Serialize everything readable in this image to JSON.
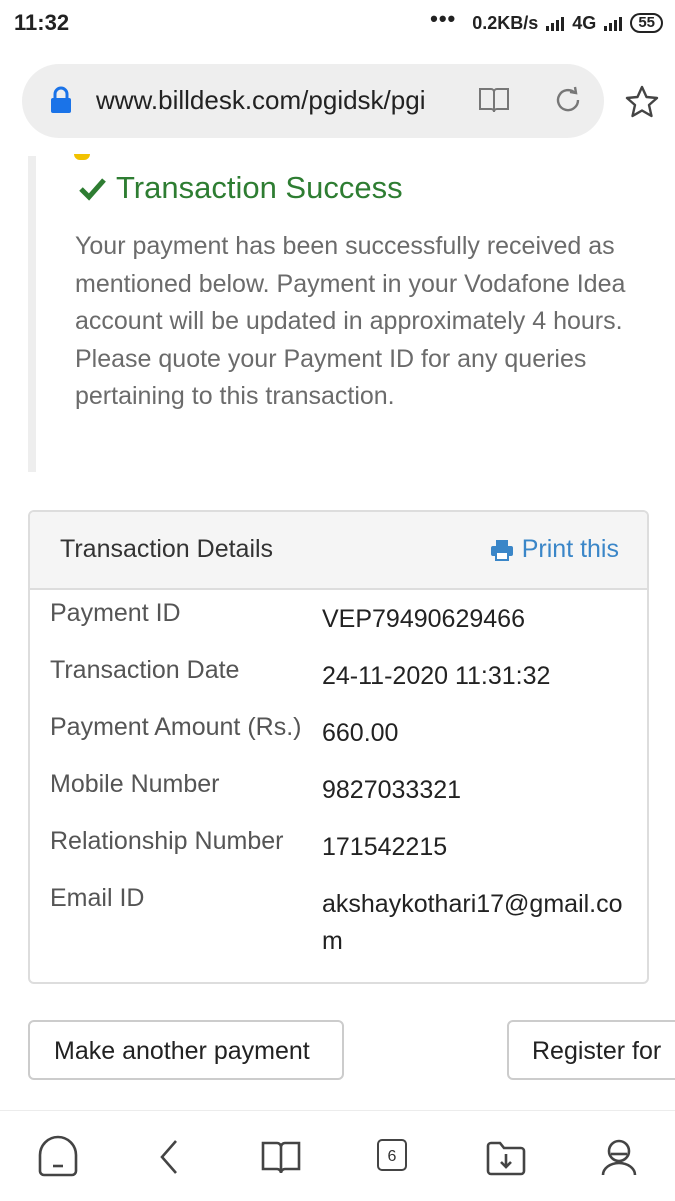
{
  "status_bar": {
    "time": "11:32",
    "network_speed": "0.2KB/s",
    "network_type": "4G",
    "battery": "55"
  },
  "browser": {
    "url": "www.billdesk.com/pgidsk/pgi"
  },
  "notice": {
    "title": "Transaction Success",
    "message": "Your payment has been successfully received as mentioned below. Payment in your Vodafone Idea account will be updated in approximately 4 hours. Please quote your Payment ID for any queries pertaining to this transaction."
  },
  "details": {
    "title": "Transaction Details",
    "print_label": "Print this",
    "rows": [
      {
        "label": "Payment ID",
        "value": "VEP79490629466"
      },
      {
        "label": "Transaction Date",
        "value": "24-11-2020 11:31:32"
      },
      {
        "label": "Payment Amount (Rs.)",
        "value": "660.00"
      },
      {
        "label": "Mobile Number",
        "value": "9827033321"
      },
      {
        "label": "Relationship Number",
        "value": "171542215"
      },
      {
        "label": "Email ID",
        "value": "akshaykothari17@gmail.com"
      }
    ]
  },
  "actions": {
    "make_another": "Make another payment",
    "register": "Register for"
  },
  "bottom_nav": {
    "tab_count": "6"
  },
  "colors": {
    "success": "#2e7d32",
    "link": "#3a86c8",
    "lock": "#1a73e8"
  }
}
